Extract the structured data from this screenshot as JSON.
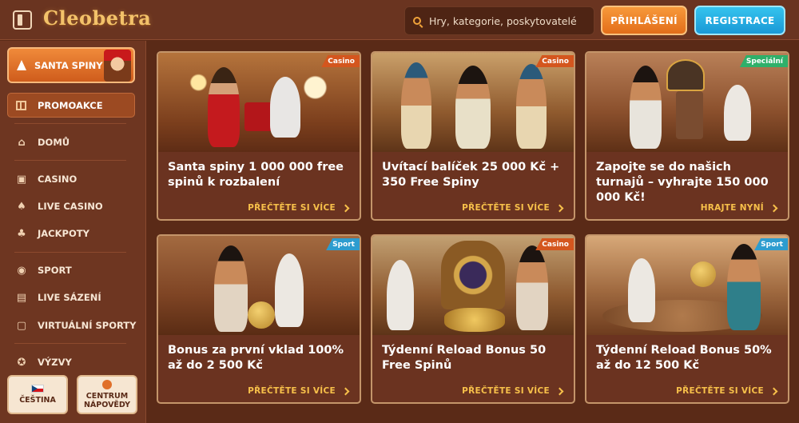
{
  "header": {
    "logo": "Cleobetra",
    "search_placeholder": "Hry, kategorie, poskytovatelé",
    "login_label": "PŘIHLÁŠENÍ",
    "register_label": "REGISTRACE"
  },
  "sidebar": {
    "santa_label": "SANTA SPINY",
    "promo_label": "PROMOAKCE",
    "items": [
      {
        "label": "DOMŮ",
        "icon": "home-icon"
      },
      {
        "label": "CASINO",
        "icon": "slot-machine-icon"
      },
      {
        "label": "LIVE CASINO",
        "icon": "cards-icon"
      },
      {
        "label": "JACKPOTY",
        "icon": "clover-icon"
      },
      {
        "label": "SPORT",
        "icon": "ball-icon"
      },
      {
        "label": "LIVE SÁZENÍ",
        "icon": "live-icon"
      },
      {
        "label": "VIRTUÁLNÍ SPORTY",
        "icon": "virtual-icon"
      },
      {
        "label": "VÝZVY",
        "icon": "challenge-icon"
      }
    ],
    "language_label": "ČEŠTINA",
    "help_label_1": "CENTRUM",
    "help_label_2": "NÁPOVĚDY"
  },
  "cards": [
    {
      "badge": "Casino",
      "title": "Santa spiny 1 000 000 free spinů k rozbalení",
      "link": "PŘEČTĚTE SI VÍCE"
    },
    {
      "badge": "Casino",
      "title": "Uvítací balíček 25 000 Kč + 350 Free Spiny",
      "link": "PŘEČTĚTE SI VÍCE"
    },
    {
      "badge": "Speciální",
      "title": "Zapojte se do našich turnajů – vyhrajte 150 000 000 Kč!",
      "link": "HRAJTE NYNÍ"
    },
    {
      "badge": "Sport",
      "title": "Bonus za první vklad 100% až do 2 500 Kč",
      "link": "PŘEČTĚTE SI VÍCE"
    },
    {
      "badge": "Casino",
      "title": "Týdenní Reload Bonus 50 Free Spinů",
      "link": "PŘEČTĚTE SI VÍCE"
    },
    {
      "badge": "Sport",
      "title": "Týdenní Reload Bonus 50% až do 12 500 Kč",
      "link": "PŘEČTĚTE SI VÍCE"
    }
  ],
  "colors": {
    "background": "#5a2a17",
    "accent_orange": "#e36e1a",
    "accent_blue": "#1a98d6",
    "link_gold": "#f7c04a",
    "badge_casino": "#d4561e",
    "badge_special": "#2fb06a",
    "badge_sport": "#2d9ccf"
  }
}
